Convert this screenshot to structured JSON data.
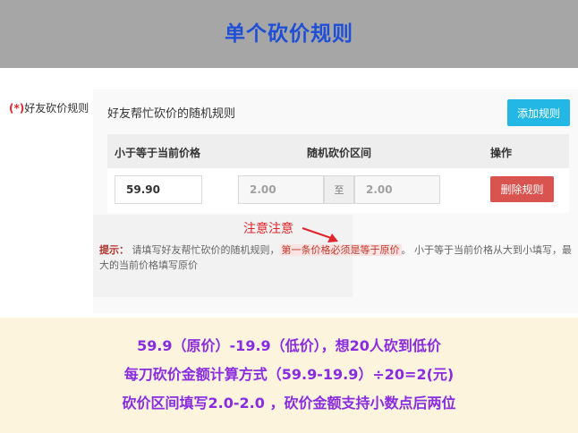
{
  "header": {
    "title": "单个砍价规则"
  },
  "field": {
    "required_mark": "(*)",
    "label": "好友砍价规则"
  },
  "panel": {
    "title": "好友帮忙砍价的随机规则",
    "add_button": "添加规则",
    "columns": [
      "小于等于当前价格",
      "随机砍价区间",
      "操作"
    ],
    "row": {
      "price": "59.90",
      "range_min": "2.00",
      "range_sep": "至",
      "range_max": "2.00",
      "delete_button": "删除规则"
    }
  },
  "annotation": "注意注意",
  "hint": {
    "label": "提示：",
    "text1": "请填写好友帮忙砍价的随机规则，",
    "highlight": "第一条价格必须是等于原价",
    "text2": "。 小于等于当前价格从大到小填写，最大的当前价格填写原价"
  },
  "explanation": {
    "line1": "59.9（原价）-19.9（低价），想20人砍到低价",
    "line2": "每刀砍价金额计算方式（59.9-19.9）÷20=2(元)",
    "line3": "砍价区间填写2.0-2.0 ，砍价金额支持小数点后两位"
  }
}
